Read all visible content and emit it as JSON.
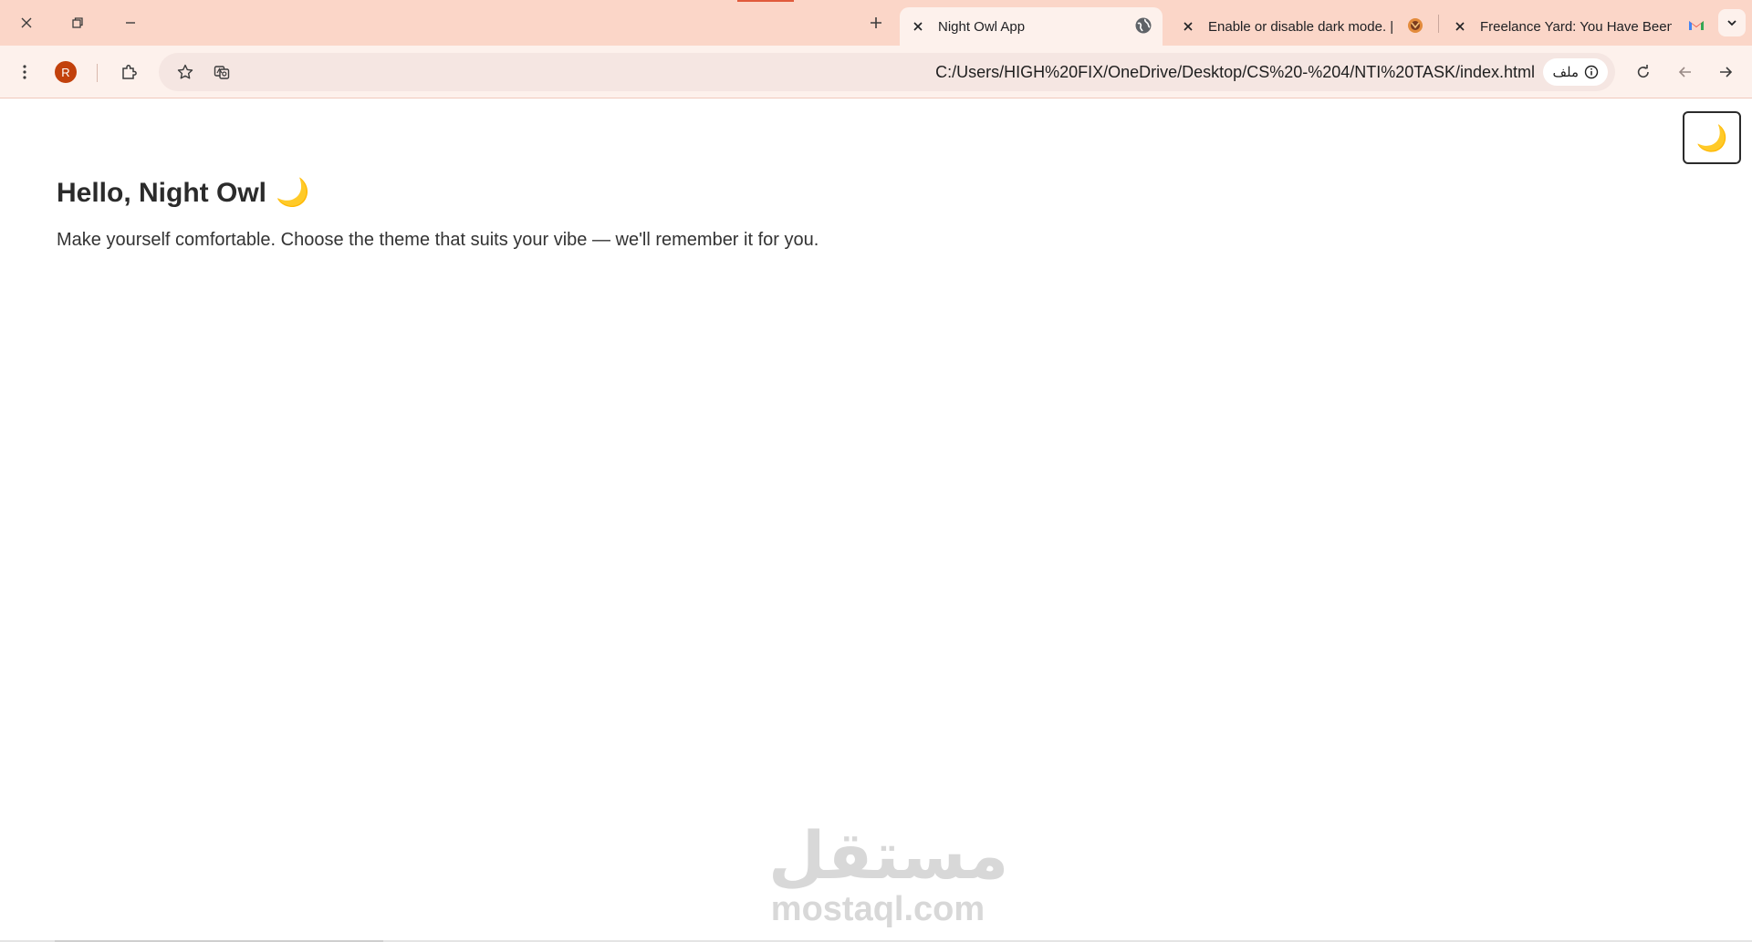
{
  "browser": {
    "tabs": [
      {
        "title": "Night Owl App",
        "active": true,
        "favicon": "globe-icon"
      },
      {
        "title": "Enable or disable dark mode. | F",
        "active": false,
        "favicon": "mastery-icon"
      },
      {
        "title": "Freelance Yard: You Have Been",
        "active": false,
        "favicon": "gmail-icon"
      }
    ],
    "profile_initial": "R",
    "address": {
      "url": "C:/Users/HIGH%20FIX/OneDrive/Desktop/CS%20-%204/NTI%20TASK/index.html",
      "chip_label": "ملف"
    }
  },
  "page": {
    "theme_toggle_icon": "🌙",
    "greeting": "Hello, Night Owl",
    "greeting_emoji": "🌙",
    "tagline": "Make yourself comfortable. Choose the theme that suits your vibe — we'll remember it for you."
  },
  "watermark": {
    "arabic": "مستقل",
    "latin": "mostaql.com"
  },
  "colors": {
    "tabstrip": "#fbd6c8",
    "toolbar": "#fdf1ec",
    "avatar": "#c2410c",
    "accent": "#e05a3c"
  }
}
